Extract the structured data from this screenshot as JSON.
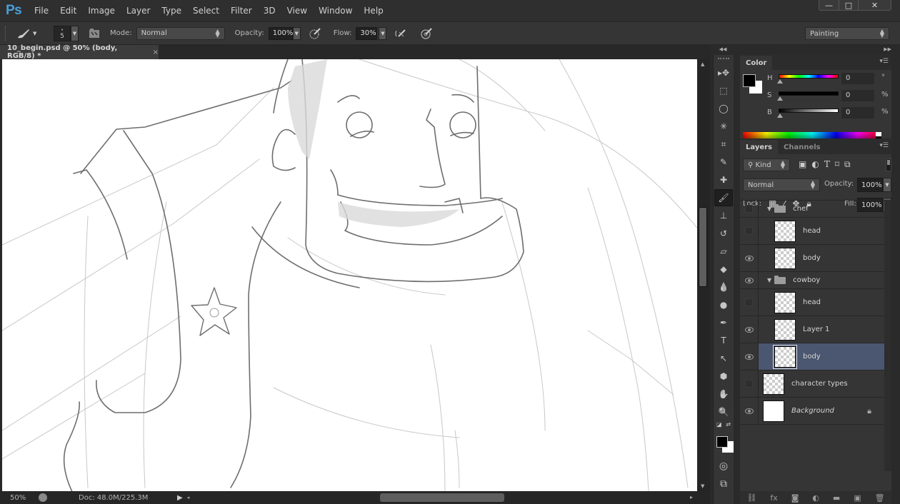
{
  "app": {
    "logo": "Ps",
    "menu": [
      "File",
      "Edit",
      "Image",
      "Layer",
      "Type",
      "Select",
      "Filter",
      "3D",
      "View",
      "Window",
      "Help"
    ],
    "window_controls": {
      "minimize": "—",
      "maximize": "□",
      "close": "✕"
    }
  },
  "options_bar": {
    "brush_size": "5",
    "mode_label": "Mode:",
    "mode_value": "Normal",
    "opacity_label": "Opacity:",
    "opacity_value": "100%",
    "flow_label": "Flow:",
    "flow_value": "30%",
    "workspace": "Painting"
  },
  "document": {
    "tab_title": "10_begin.psd @ 50% (body, RGB/8) *",
    "tab_close": "×"
  },
  "status": {
    "zoom": "50%",
    "doc_size": "Doc: 48.0M/225.3M",
    "arrow": "▶",
    "arrow_left": "◂"
  },
  "tools": [
    {
      "name": "move-tool",
      "glyph": "▸✥"
    },
    {
      "name": "marquee-tool",
      "glyph": "⬚"
    },
    {
      "name": "lasso-tool",
      "glyph": "◯"
    },
    {
      "name": "magic-wand-tool",
      "glyph": "✳"
    },
    {
      "name": "crop-tool",
      "glyph": "⌗"
    },
    {
      "name": "eyedropper-tool",
      "glyph": "✎"
    },
    {
      "name": "healing-brush-tool",
      "glyph": "✚"
    },
    {
      "name": "brush-tool",
      "glyph": "🖌",
      "active": true
    },
    {
      "name": "clone-stamp-tool",
      "glyph": "⊥"
    },
    {
      "name": "history-brush-tool",
      "glyph": "↺"
    },
    {
      "name": "eraser-tool",
      "glyph": "▱"
    },
    {
      "name": "paint-bucket-tool",
      "glyph": "◆"
    },
    {
      "name": "blur-tool",
      "glyph": "💧"
    },
    {
      "name": "dodge-tool",
      "glyph": "●"
    },
    {
      "name": "pen-tool",
      "glyph": "✒"
    },
    {
      "name": "type-tool",
      "glyph": "T"
    },
    {
      "name": "path-selection-tool",
      "glyph": "↖"
    },
    {
      "name": "shape-tool",
      "glyph": "⬢"
    },
    {
      "name": "hand-tool",
      "glyph": "✋"
    },
    {
      "name": "zoom-tool",
      "glyph": "🔍"
    }
  ],
  "color_panel": {
    "tab": "Color",
    "rows": [
      {
        "label": "H",
        "value": "0",
        "unit": "°"
      },
      {
        "label": "S",
        "value": "0",
        "unit": "%"
      },
      {
        "label": "B",
        "value": "0",
        "unit": "%"
      }
    ],
    "foreground": "#000000",
    "background": "#ffffff"
  },
  "layers_panel": {
    "tabs": [
      "Layers",
      "Channels"
    ],
    "filter_kind": "Kind",
    "blend_mode": "Normal",
    "opacity_label": "Opacity:",
    "opacity_value": "100%",
    "lock_label": "Lock:",
    "fill_label": "Fill:",
    "fill_value": "100%",
    "layers": [
      {
        "name": "chef",
        "type": "group",
        "visible": false,
        "indent": 0
      },
      {
        "name": "head",
        "type": "layer",
        "visible": false,
        "indent": 1
      },
      {
        "name": "body",
        "type": "layer",
        "visible": true,
        "indent": 1
      },
      {
        "name": "cowboy",
        "type": "group",
        "visible": true,
        "indent": 0
      },
      {
        "name": "head",
        "type": "layer",
        "visible": false,
        "indent": 1
      },
      {
        "name": "Layer 1",
        "type": "layer",
        "visible": true,
        "indent": 1
      },
      {
        "name": "body",
        "type": "layer",
        "visible": true,
        "indent": 1,
        "selected": true
      },
      {
        "name": "character types",
        "type": "layer",
        "visible": false,
        "indent": 0
      },
      {
        "name": "Background",
        "type": "background",
        "visible": true,
        "indent": 0,
        "locked": true
      }
    ],
    "footer_icons": [
      "link-icon",
      "fx-icon",
      "mask-icon",
      "adjustment-icon",
      "folder-icon",
      "new-layer-icon",
      "trash-icon"
    ],
    "footer_glyphs": [
      "⛓",
      "fx",
      "◙",
      "◐",
      "▬",
      "▣",
      "🗑"
    ]
  }
}
